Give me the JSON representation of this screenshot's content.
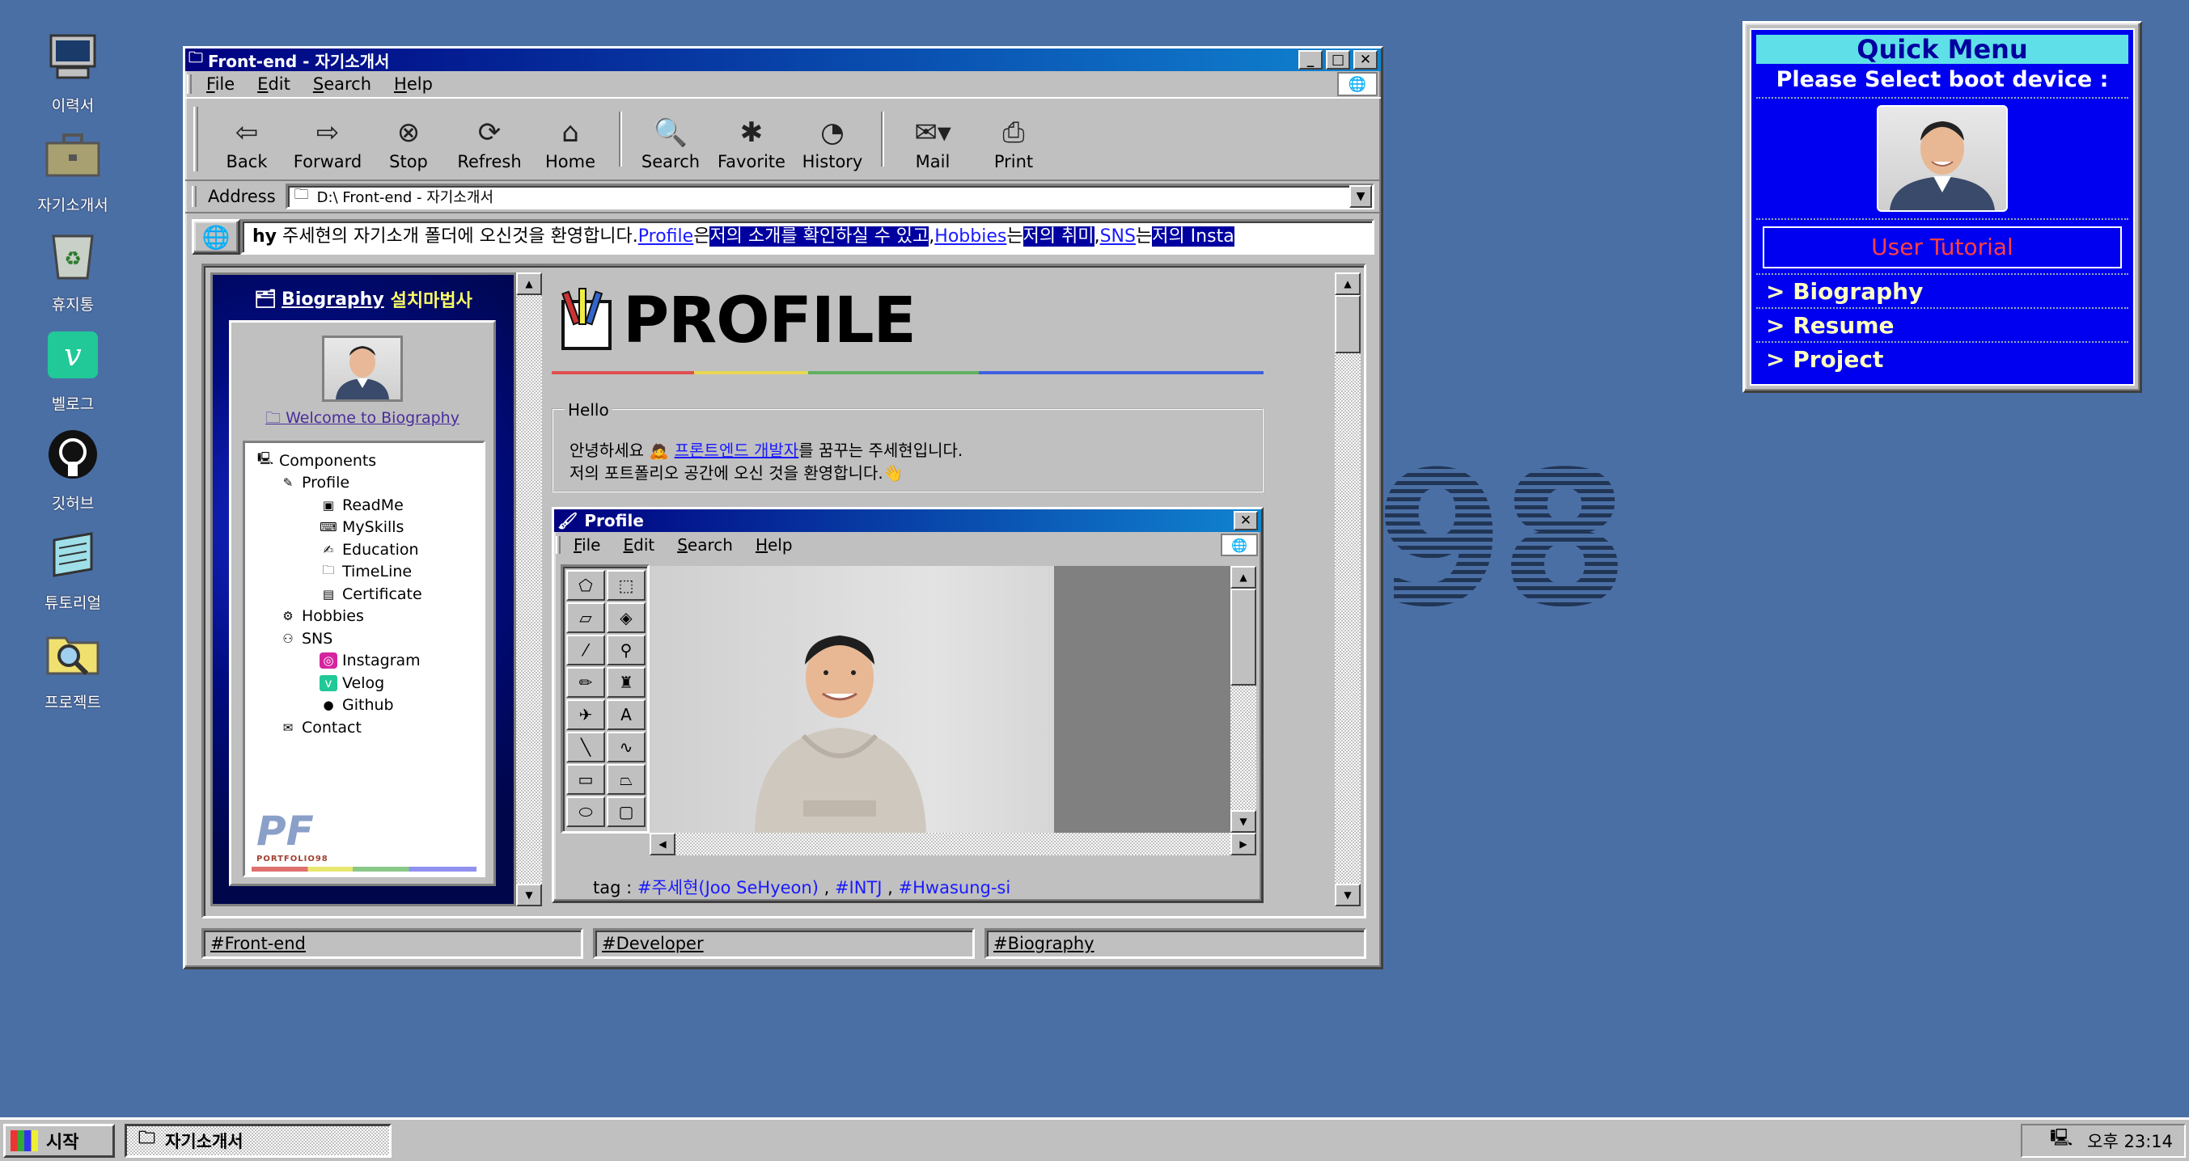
{
  "desktop": {
    "icons": [
      {
        "label": "이력서",
        "icon": "computer-icon"
      },
      {
        "label": "자기소개서",
        "icon": "briefcase-icon"
      },
      {
        "label": "휴지통",
        "icon": "recycle-bin-icon"
      },
      {
        "label": "벨로그",
        "icon": "velog-icon"
      },
      {
        "label": "깃허브",
        "icon": "github-icon"
      },
      {
        "label": "튜토리얼",
        "icon": "notepad-icon"
      },
      {
        "label": "프로젝트",
        "icon": "folder-search-icon"
      }
    ],
    "watermark": "98"
  },
  "window": {
    "title": "Front-end - 자기소개서",
    "menu": [
      "File",
      "Edit",
      "Search",
      "Help"
    ],
    "toolbar": [
      {
        "label": "Back",
        "icon": "back-arrow-icon"
      },
      {
        "label": "Forward",
        "icon": "forward-arrow-icon"
      },
      {
        "label": "Stop",
        "icon": "stop-icon"
      },
      {
        "label": "Refresh",
        "icon": "refresh-icon"
      },
      {
        "label": "Home",
        "icon": "home-icon"
      },
      {
        "label": "Search",
        "icon": "search-globe-icon"
      },
      {
        "label": "Favorite",
        "icon": "favorite-folder-icon"
      },
      {
        "label": "History",
        "icon": "history-icon"
      },
      {
        "label": "Mail",
        "icon": "mail-icon"
      },
      {
        "label": "Print",
        "icon": "printer-icon"
      }
    ],
    "address_label": "Address",
    "address_value": "D:\\ Front-end - 자기소개서",
    "ticker": {
      "prefix": "hy",
      "text1": " 주세현의 자기소개 폴더에 오신것을 환영합니다.",
      "link_profile": "Profile",
      "t2": "은",
      "hl1": "저의 소개를 확인하실 수 있고",
      "t3": ",",
      "link_hobbies": "Hobbies",
      "t4": "는",
      "hl2": "저의 취미",
      "t5": ",",
      "link_sns": "SNS",
      "t6": "는",
      "hl3": "저의 Insta"
    }
  },
  "sidebar": {
    "title_link": "Biography",
    "title_rest": "설치마법사",
    "welcome": "Welcome to Biography",
    "tree": [
      {
        "label": "Components",
        "level": 0
      },
      {
        "label": "Profile",
        "level": 1
      },
      {
        "label": "ReadMe",
        "level": 2
      },
      {
        "label": "MySkills",
        "level": 2
      },
      {
        "label": "Education",
        "level": 2
      },
      {
        "label": "TimeLine",
        "level": 2
      },
      {
        "label": "Certificate",
        "level": 2
      },
      {
        "label": "Hobbies",
        "level": 1
      },
      {
        "label": "SNS",
        "level": 1
      },
      {
        "label": "Instagram",
        "level": 2
      },
      {
        "label": "Velog",
        "level": 2
      },
      {
        "label": "Github",
        "level": 2
      },
      {
        "label": "Contact",
        "level": 1
      }
    ],
    "logo_text": "PF",
    "logo_sub": "PORTFOLIO98"
  },
  "doc": {
    "heading": "PROFILE",
    "hello_legend": "Hello",
    "line1_a": "안녕하세요 🙇 ",
    "line1_link": "프론트엔드 개발자",
    "line1_b": "를 꿈꾸는 주세현입니다.",
    "line2": "저의 포트폴리오 공간에 오신 것을 환영합니다.👋",
    "paint_title": "Profile",
    "paint_menu": [
      "File",
      "Edit",
      "Search",
      "Help"
    ],
    "tag_label": "tag : ",
    "tags": [
      "#주세현(Joo SeHyeon)",
      "#INTJ",
      "#Hwasung-si"
    ]
  },
  "bottom_tags": [
    "#Front-end",
    "#Developer",
    "#Biography"
  ],
  "quick_menu": {
    "title": "Quick Menu",
    "subtitle": "Please Select boot device :",
    "tutorial": "User Tutorial",
    "items": [
      "> Biography",
      "> Resume",
      "> Project"
    ]
  },
  "taskbar": {
    "start": "시작",
    "task": "자기소개서",
    "clock": "오후 23:14"
  }
}
